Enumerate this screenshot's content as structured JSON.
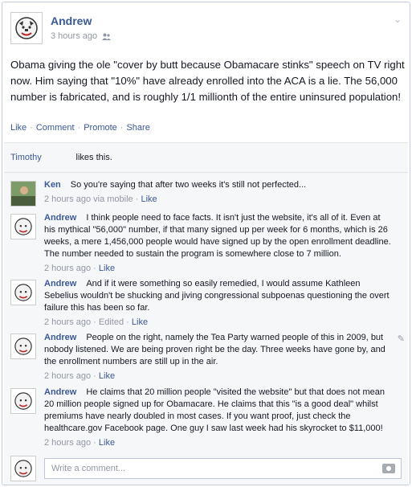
{
  "post": {
    "author": "Andrew",
    "timestamp": "3 hours ago",
    "text": "Obama giving the ole \"cover by butt because Obamacare stinks\" speech on TV right now. Him saying that \"10%\" have already enrolled into the ACA is a lie. The 56,000 number is fabricated, and is roughly 1/1 millionth of the entire uninsured population!"
  },
  "actions": {
    "like": "Like",
    "comment": "Comment",
    "promote": "Promote",
    "share": "Share",
    "sep": "·"
  },
  "likes": {
    "name": "Timothy",
    "suffix": "likes this."
  },
  "comments": [
    {
      "author": "Ken",
      "text": "So you're saying that after two weeks it's still not perfected...",
      "time": "2 hours ago via mobile",
      "sep": "·",
      "like": "Like"
    },
    {
      "author": "Andrew",
      "text": "I think people need to face facts. It isn't just the website, it's all of it. Even at his mythical \"56,000\" number, if that many signed up per week for 6 months, which is 26 weeks, a mere 1,456,000 people would have signed up by the open enrollment deadline. The number needed to sustain the program is somewhere close to 7 million.",
      "time": "2 hours ago",
      "sep": "·",
      "like": "Like"
    },
    {
      "author": "Andrew",
      "text": "And if it were something so easily remedied, I would assume Kathleen Sebelius wouldn't be shucking and jiving congressional subpoenas questioning the overt failure this has been so far.",
      "time": "2 hours ago",
      "edited": "Edited",
      "sep": "·",
      "like": "Like"
    },
    {
      "author": "Andrew",
      "text": "People on the right, namely the Tea Party warned people of this in 2009, but nobody listened. We are being proven right be the day. Three weeks have gone by, and the enrollment numbers are still up in the air.",
      "time": "2 hours ago",
      "sep": "·",
      "like": "Like"
    },
    {
      "author": "Andrew",
      "text": "He claims that 20 million people \"visited the website\" but that does not mean 20 million people signed up for Obamacare. He claims that this \"is a good deal\" whilst premiums have nearly doubled in most cases. If you want proof, just check the healthcare.gov Facebook page. One guy I saw last week had his skyrocket to $11,000!",
      "time": "2 hours ago",
      "sep": "·",
      "like": "Like"
    }
  ],
  "composer": {
    "placeholder": "Write a comment..."
  },
  "icons": {
    "chevron": "chevron-down-icon",
    "privacy": "friends-privacy-icon",
    "camera": "camera-icon",
    "pencil": "edit-pencil-icon"
  }
}
